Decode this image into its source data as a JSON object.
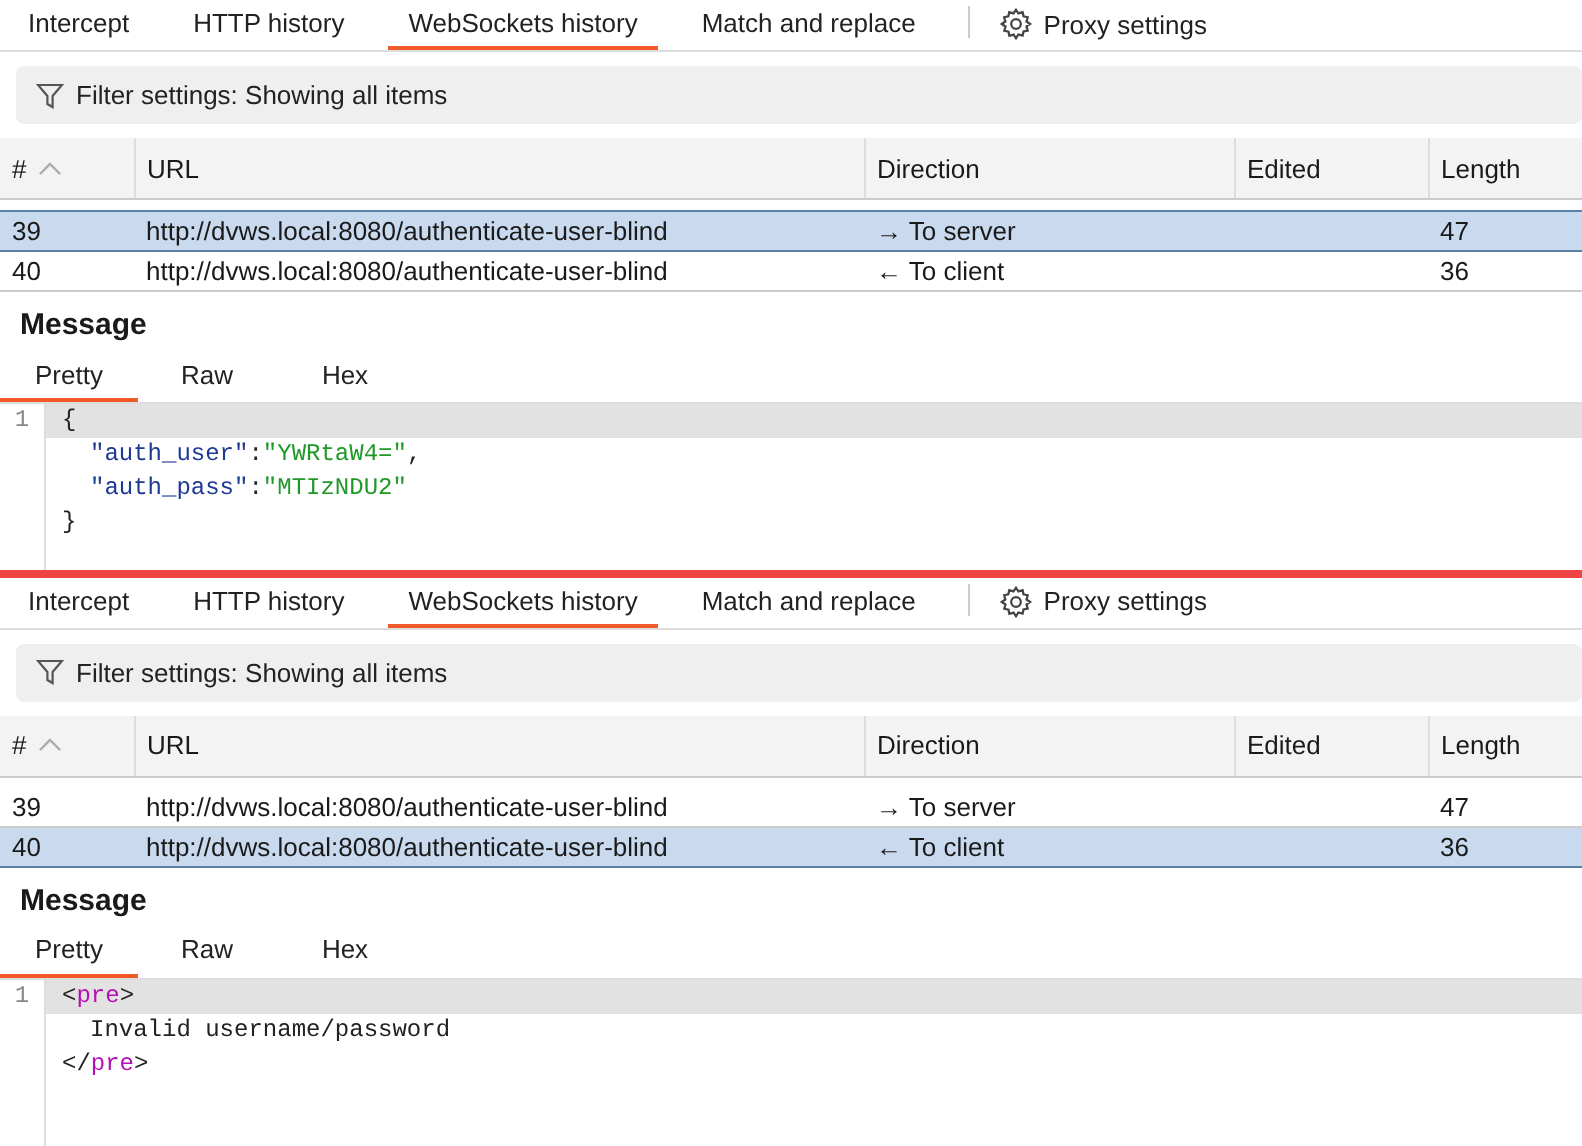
{
  "panels": [
    {
      "tabs": [
        {
          "label": "Intercept",
          "selected": false
        },
        {
          "label": "HTTP history",
          "selected": false
        },
        {
          "label": "WebSockets history",
          "selected": true
        },
        {
          "label": "Match and replace",
          "selected": false
        }
      ],
      "proxy_settings": "Proxy settings",
      "filter": "Filter settings: Showing all items",
      "table": {
        "columns": [
          "#",
          "URL",
          "Direction",
          "Edited",
          "Length"
        ],
        "rows": [
          {
            "selected": true,
            "cells": [
              "39",
              "http://dvws.local:8080/authenticate-user-blind",
              "→ To server",
              "",
              "47"
            ]
          },
          {
            "selected": false,
            "cells": [
              "40",
              "http://dvws.local:8080/authenticate-user-blind",
              "← To client",
              "",
              "36"
            ]
          }
        ]
      },
      "message": {
        "title": "Message",
        "tabs": [
          {
            "label": "Pretty",
            "selected": true
          },
          {
            "label": "Raw",
            "selected": false
          },
          {
            "label": "Hex",
            "selected": false
          }
        ],
        "lines": [
          {
            "number": "1",
            "highlighted": true,
            "tokens": [
              {
                "kind": "punct",
                "text": "{"
              }
            ]
          },
          {
            "highlighted": false,
            "indented": true,
            "tokens": [
              {
                "kind": "key",
                "text": "\"auth_user\""
              },
              {
                "kind": "punct",
                "text": ":"
              },
              {
                "kind": "string",
                "text": "\"YWRtaW4=\""
              },
              {
                "kind": "punct",
                "text": ","
              }
            ]
          },
          {
            "highlighted": false,
            "indented": true,
            "tokens": [
              {
                "kind": "key",
                "text": "\"auth_pass\""
              },
              {
                "kind": "punct",
                "text": ":"
              },
              {
                "kind": "string",
                "text": "\"MTIzNDU2\""
              }
            ]
          },
          {
            "highlighted": false,
            "tokens": [
              {
                "kind": "punct",
                "text": "}"
              }
            ]
          }
        ]
      }
    },
    {
      "tabs": [
        {
          "label": "Intercept",
          "selected": false
        },
        {
          "label": "HTTP history",
          "selected": false
        },
        {
          "label": "WebSockets history",
          "selected": true
        },
        {
          "label": "Match and replace",
          "selected": false
        }
      ],
      "proxy_settings": "Proxy settings",
      "filter": "Filter settings: Showing all items",
      "table": {
        "columns": [
          "#",
          "URL",
          "Direction",
          "Edited",
          "Length"
        ],
        "rows": [
          {
            "selected": false,
            "cells": [
              "39",
              "http://dvws.local:8080/authenticate-user-blind",
              "→ To server",
              "",
              "47"
            ]
          },
          {
            "selected": true,
            "cells": [
              "40",
              "http://dvws.local:8080/authenticate-user-blind",
              "← To client",
              "",
              "36"
            ]
          }
        ]
      },
      "message": {
        "title": "Message",
        "tabs": [
          {
            "label": "Pretty",
            "selected": true
          },
          {
            "label": "Raw",
            "selected": false
          },
          {
            "label": "Hex",
            "selected": false
          }
        ],
        "lines": [
          {
            "number": "1",
            "highlighted": true,
            "tokens": [
              {
                "kind": "punct",
                "text": "<"
              },
              {
                "kind": "tag",
                "text": "pre"
              },
              {
                "kind": "punct",
                "text": ">"
              }
            ]
          },
          {
            "highlighted": false,
            "indented": true,
            "tokens": [
              {
                "kind": "text",
                "text": "Invalid username/password"
              }
            ]
          },
          {
            "highlighted": false,
            "tokens": [
              {
                "kind": "punct",
                "text": "</"
              },
              {
                "kind": "tag",
                "text": "pre"
              },
              {
                "kind": "punct",
                "text": ">"
              }
            ]
          }
        ]
      }
    }
  ]
}
